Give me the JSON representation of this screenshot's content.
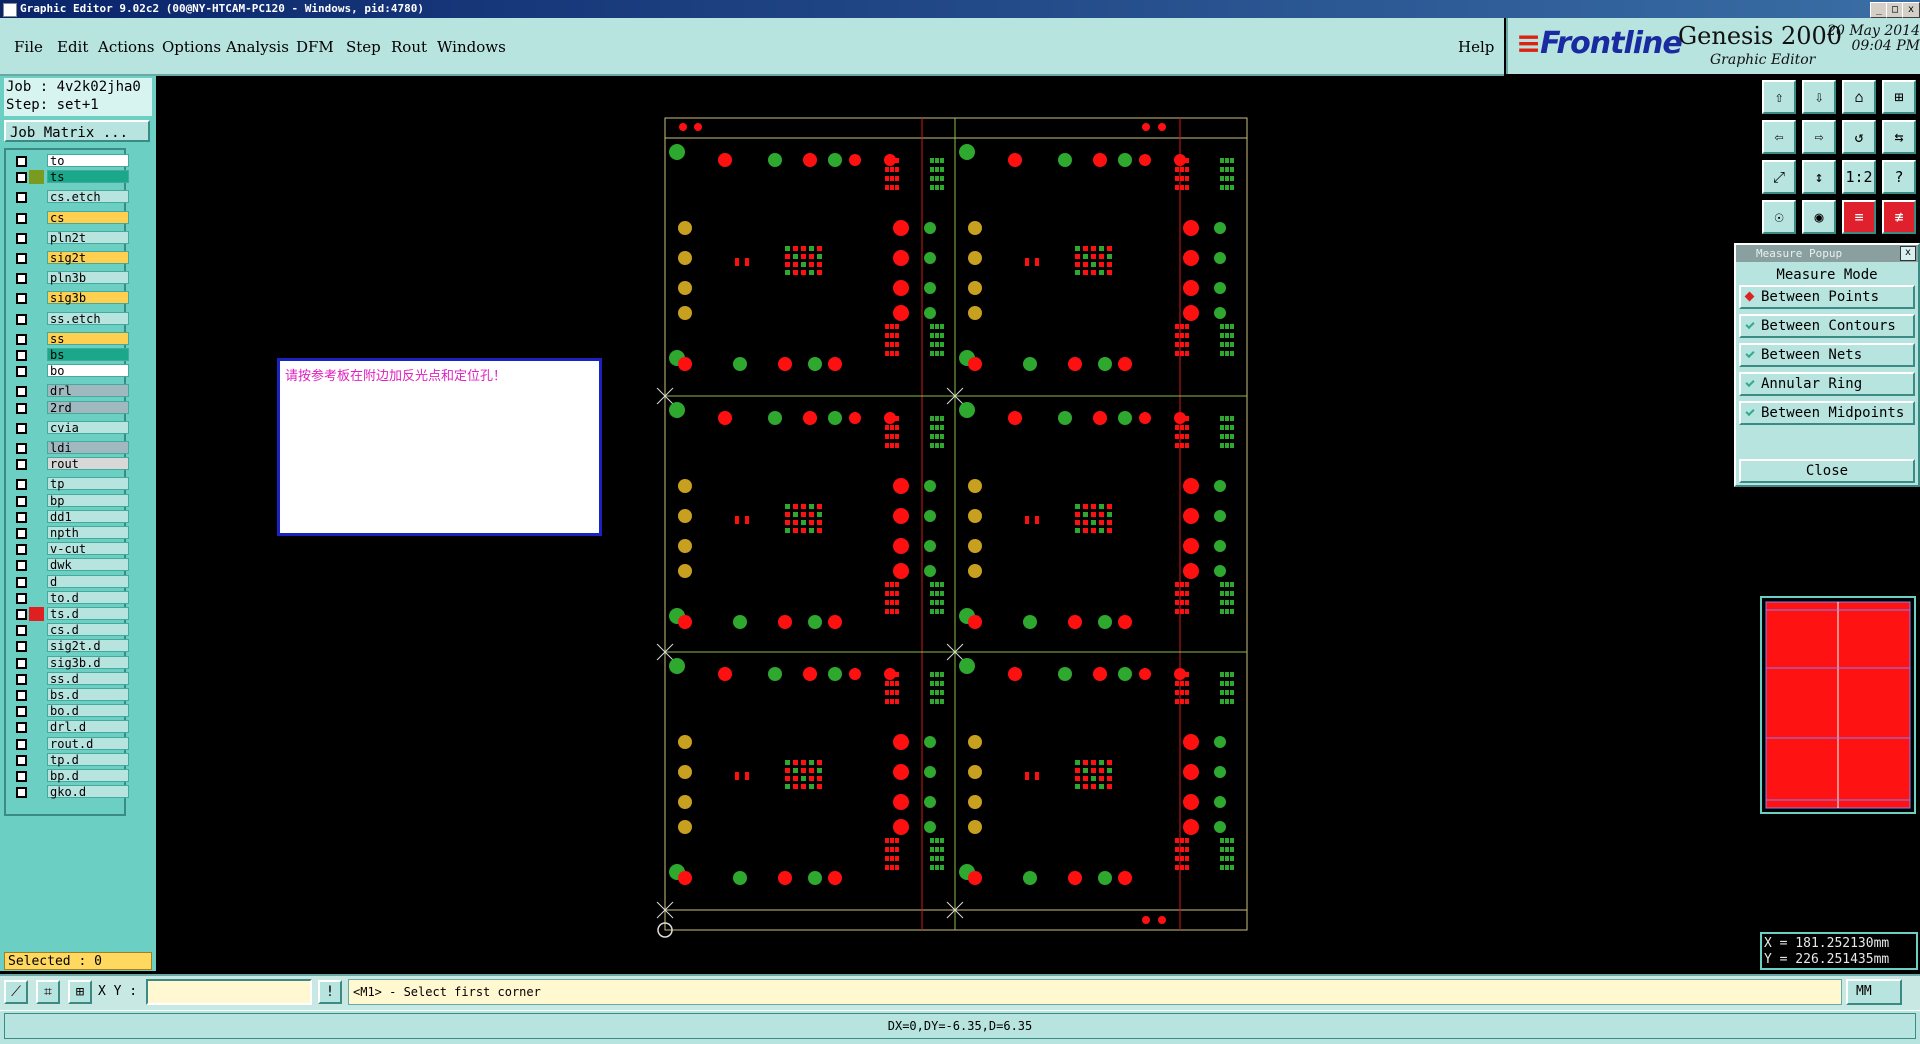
{
  "window": {
    "title": "Graphic Editor 9.02c2 (00@NY-HTCAM-PC120 - Windows, pid:4780)",
    "btn_min": "_",
    "btn_max": "□",
    "btn_close": "x"
  },
  "menu": {
    "items": [
      "File",
      "Edit",
      "Actions",
      "Options",
      "Analysis",
      "DFM",
      "Step",
      "Rout",
      "Windows"
    ],
    "help": "Help"
  },
  "brand": {
    "logo_prefix": "≡",
    "logo": "Frontline",
    "product": "Genesis 2000",
    "subtitle": "Graphic Editor",
    "date": "20 May 2014",
    "time": "09:04 PM"
  },
  "job": {
    "job_line": "Job : 4v2k02jha0",
    "step_line": "Step: set+1",
    "matrix_button": "Job Matrix ..."
  },
  "layers": [
    {
      "name": "to",
      "color": "#ffffff",
      "swatch": "",
      "gap": 0
    },
    {
      "name": "ts",
      "color": "#1ba88a",
      "swatch": "#7a9a20",
      "gap": 0
    },
    {
      "name": "cs.etch",
      "color": "#b8e4e0",
      "swatch": "",
      "gap": 4
    },
    {
      "name": "cs",
      "color": "#ffd050",
      "swatch": "",
      "gap": 4
    },
    {
      "name": "pln2t",
      "color": "#b8e4e0",
      "swatch": "",
      "gap": 4
    },
    {
      "name": "sig2t",
      "color": "#ffd050",
      "swatch": "",
      "gap": 4
    },
    {
      "name": "pln3b",
      "color": "#b8e4e0",
      "swatch": "",
      "gap": 4
    },
    {
      "name": "sig3b",
      "color": "#ffd050",
      "swatch": "",
      "gap": 4
    },
    {
      "name": "ss.etch",
      "color": "#b8e4e0",
      "swatch": "",
      "gap": 4
    },
    {
      "name": "ss",
      "color": "#ffd050",
      "swatch": "",
      "gap": 4
    },
    {
      "name": "bs",
      "color": "#1ba88a",
      "swatch": "",
      "gap": 0
    },
    {
      "name": "bo",
      "color": "#ffffff",
      "swatch": "",
      "gap": 0
    },
    {
      "name": "drl",
      "color": "#a0b8c0",
      "swatch": "",
      "gap": 4
    },
    {
      "name": "2rd",
      "color": "#a0b8c0",
      "swatch": "",
      "gap": 0
    },
    {
      "name": "cvia",
      "color": "#b8e4e0",
      "swatch": "",
      "gap": 4
    },
    {
      "name": "ldi",
      "color": "#a0b8c0",
      "swatch": "",
      "gap": 4
    },
    {
      "name": "rout",
      "color": "#d8d8d8",
      "swatch": "",
      "gap": 0
    },
    {
      "name": "tp",
      "color": "#b8e4e0",
      "swatch": "",
      "gap": 4
    },
    {
      "name": "bp",
      "color": "#b8e4e0",
      "swatch": "",
      "gap": 0
    },
    {
      "name": "dd1",
      "color": "#b8e4e0",
      "swatch": "",
      "gap": 0
    },
    {
      "name": "npth",
      "color": "#b8e4e0",
      "swatch": "",
      "gap": 0
    },
    {
      "name": "v-cut",
      "color": "#b8e4e0",
      "swatch": "",
      "gap": 0
    },
    {
      "name": "dwk",
      "color": "#b8e4e0",
      "swatch": "",
      "gap": 0
    },
    {
      "name": "d",
      "color": "#b8e4e0",
      "swatch": "",
      "gap": 0
    },
    {
      "name": "to.d",
      "color": "#b8e4e0",
      "swatch": "",
      "gap": 0
    },
    {
      "name": "ts.d",
      "color": "#b8e4e0",
      "swatch": "#e02020",
      "gap": 0
    },
    {
      "name": "cs.d",
      "color": "#b8e4e0",
      "swatch": "",
      "gap": 0
    },
    {
      "name": "sig2t.d",
      "color": "#b8e4e0",
      "swatch": "",
      "gap": 0
    },
    {
      "name": "sig3b.d",
      "color": "#b8e4e0",
      "swatch": "",
      "gap": 0
    },
    {
      "name": "ss.d",
      "color": "#b8e4e0",
      "swatch": "",
      "gap": 0
    },
    {
      "name": "bs.d",
      "color": "#b8e4e0",
      "swatch": "",
      "gap": 0
    },
    {
      "name": "bo.d",
      "color": "#b8e4e0",
      "swatch": "",
      "gap": 0
    },
    {
      "name": "drl.d",
      "color": "#b8e4e0",
      "swatch": "",
      "gap": 0
    },
    {
      "name": "rout.d",
      "color": "#b8e4e0",
      "swatch": "",
      "gap": 0
    },
    {
      "name": "tp.d",
      "color": "#b8e4e0",
      "swatch": "",
      "gap": 0
    },
    {
      "name": "bp.d",
      "color": "#b8e4e0",
      "swatch": "",
      "gap": 0
    },
    {
      "name": "gko.d",
      "color": "#b8e4e0",
      "swatch": "",
      "gap": 0
    }
  ],
  "selected_text": "Selected : 0",
  "message": "请按参考板在附边加反光点和定位孔！",
  "toolbar_icons": [
    "top-view-icon",
    "bottom-view-icon",
    "home-icon",
    "split-window-icon",
    "pan-left-icon",
    "pan-right-icon",
    "rotate-icon",
    "mirror-icon",
    "zoom-fit-icon",
    "zoom-page-icon",
    "scale-1-2-icon",
    "help-icon",
    "snap-icon",
    "measure-icon",
    "layer-compare-icon",
    "layer-split-icon"
  ],
  "toolbar_glyphs": [
    "⇧",
    "⇩",
    "⌂",
    "⊞",
    "⇦",
    "⇨",
    "↺",
    "⇆",
    "⤢",
    "↕",
    "1:2",
    "?",
    "☉",
    "◉",
    "≡",
    "≢"
  ],
  "measure_popup": {
    "title": "Measure Popup",
    "close_glyph": "x",
    "mode_label": "Measure Mode",
    "options": [
      {
        "label": "Between Points",
        "selected": true
      },
      {
        "label": "Between Contours",
        "selected": false
      },
      {
        "label": "Between Nets",
        "selected": false
      },
      {
        "label": "Annular Ring",
        "selected": false
      },
      {
        "label": "Between Midpoints",
        "selected": false
      }
    ],
    "close_label": "Close"
  },
  "coords": {
    "x": "X = 181.252130mm",
    "y": "Y = 226.251435mm"
  },
  "command": {
    "xy_label": "X Y :",
    "xy_value": "",
    "prompt": "<M1> - Select first corner",
    "units": "MM"
  },
  "status": "DX=0,DY=-6.35,D=6.35",
  "colors": {
    "pad_red": "#ff1010",
    "pad_green": "#2ea82e",
    "pad_yellow": "#c8a020",
    "outline": "#c8c080",
    "vcut_red": "#d01818"
  }
}
